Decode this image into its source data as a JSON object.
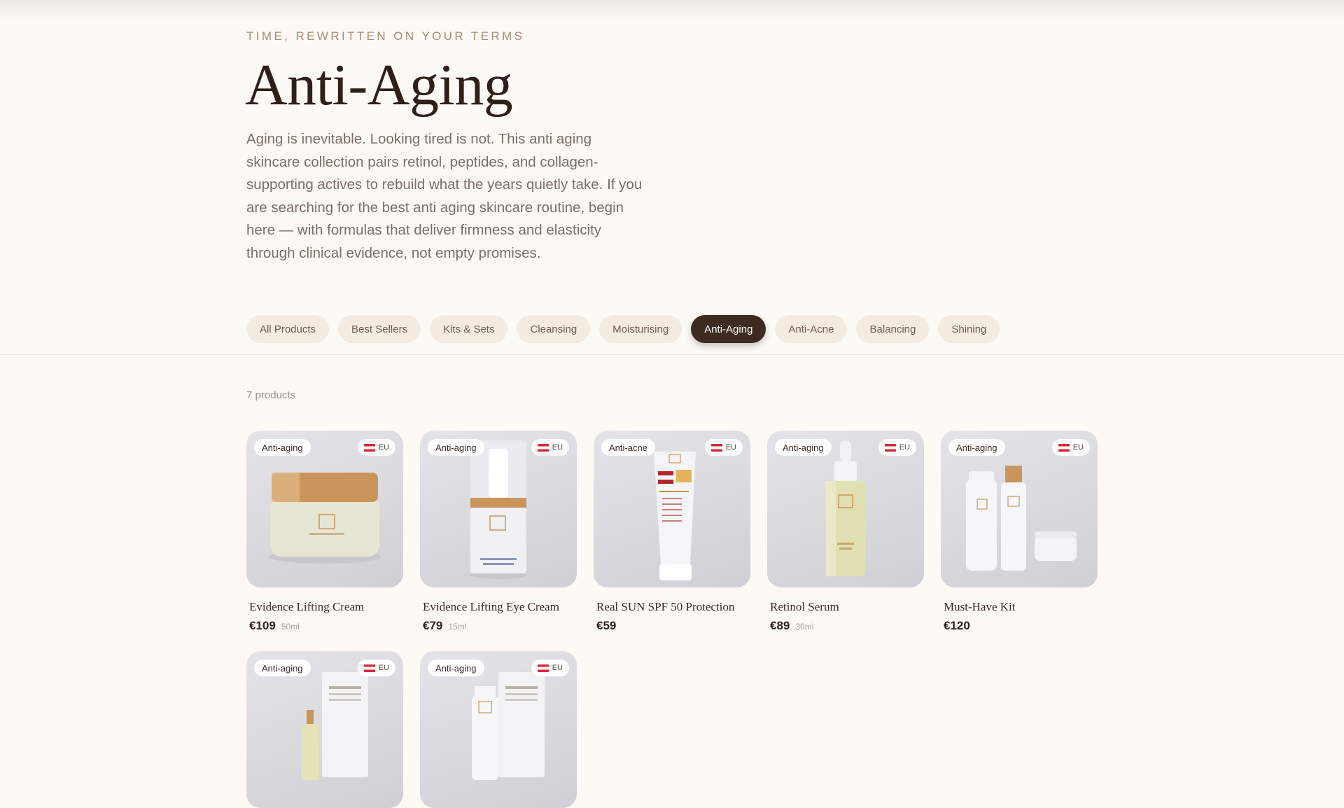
{
  "hero": {
    "eyebrow": "TIME, REWRITTEN ON YOUR TERMS",
    "title": "Anti-Aging",
    "intro": "Aging is inevitable. Looking tired is not. This anti aging skincare collection pairs retinol, peptides, and collagen-supporting actives to rebuild what the years quietly take. If you are searching for the best anti aging skincare routine, begin here — with formulas that deliver firmness and elasticity through clinical evidence, not empty promises."
  },
  "filters": [
    {
      "label": "All Products",
      "active": false
    },
    {
      "label": "Best Sellers",
      "active": false
    },
    {
      "label": "Kits & Sets",
      "active": false
    },
    {
      "label": "Cleansing",
      "active": false
    },
    {
      "label": "Moisturising",
      "active": false
    },
    {
      "label": "Anti-Aging",
      "active": true
    },
    {
      "label": "Anti-Acne",
      "active": false
    },
    {
      "label": "Balancing",
      "active": false
    },
    {
      "label": "Shining",
      "active": false
    }
  ],
  "results": {
    "count_label": "7 products"
  },
  "products": [
    {
      "badge": "Anti-aging",
      "region": "EU",
      "name": "Evidence Lifting Cream",
      "price": "€109",
      "size": "50ml",
      "icon": "cream-jar-icon"
    },
    {
      "badge": "Anti-aging",
      "region": "EU",
      "name": "Evidence Lifting Eye Cream",
      "price": "€79",
      "size": "15ml",
      "icon": "airless-pump-icon"
    },
    {
      "badge": "Anti-acne",
      "region": "EU",
      "name": "Real SUN SPF 50 Protection",
      "price": "€59",
      "size": "",
      "icon": "sunscreen-tube-icon"
    },
    {
      "badge": "Anti-aging",
      "region": "EU",
      "name": "Retinol Serum",
      "price": "€89",
      "size": "30ml",
      "icon": "dropper-bottle-icon"
    },
    {
      "badge": "Anti-aging",
      "region": "EU",
      "name": "Must-Have Kit",
      "price": "€120",
      "size": "",
      "icon": "kit-icon"
    },
    {
      "badge": "Anti-aging",
      "region": "EU",
      "name": "",
      "price": "",
      "size": "",
      "icon": "serum-mask-kit-icon"
    },
    {
      "badge": "Anti-aging",
      "region": "EU",
      "name": "",
      "price": "",
      "size": "",
      "icon": "cream-mask-kit-icon"
    }
  ],
  "colors": {
    "background": "#fdfaf6",
    "pill": "#f4ebe3",
    "pill_active": "#3d2a22",
    "heading": "#2f1f18",
    "gold": "#c9955a"
  }
}
